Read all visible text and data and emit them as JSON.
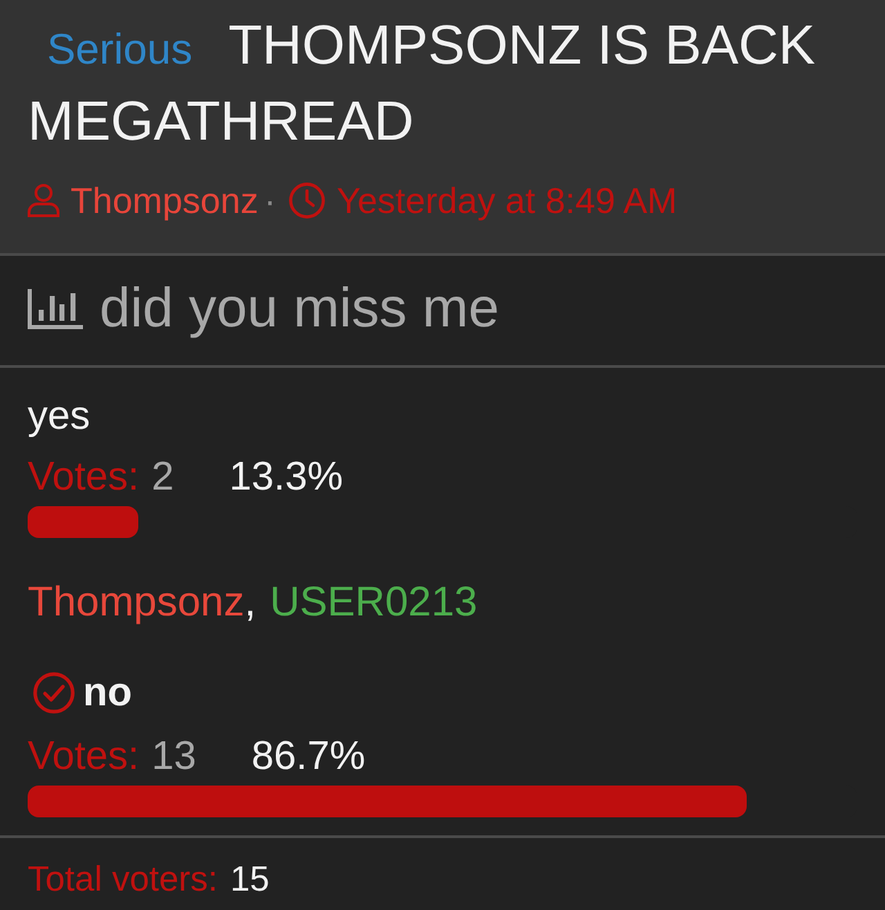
{
  "thread": {
    "prefix": "Serious",
    "title_lines": [
      "THOMPSONZ IS BACK",
      "MEGATHREAD"
    ],
    "author": "Thompsonz",
    "separator": "·",
    "time": "Yesterday at 8:49 AM"
  },
  "poll": {
    "question": "did you miss me",
    "options": [
      {
        "label": "yes",
        "selected": false,
        "votes_label": "Votes:",
        "votes": "2",
        "percent": "13.3%",
        "level": 0.133,
        "voter_separator": ",",
        "voters": [
          {
            "name": "Thompsonz",
            "color": "#e8483b"
          },
          {
            "name": "USER0213",
            "color": "#4cae4c"
          }
        ]
      },
      {
        "label": "no",
        "selected": true,
        "votes_label": "Votes:",
        "votes": "13",
        "percent": "86.7%",
        "level": 0.867
      }
    ],
    "total_label": "Total voters:",
    "total": "15"
  }
}
